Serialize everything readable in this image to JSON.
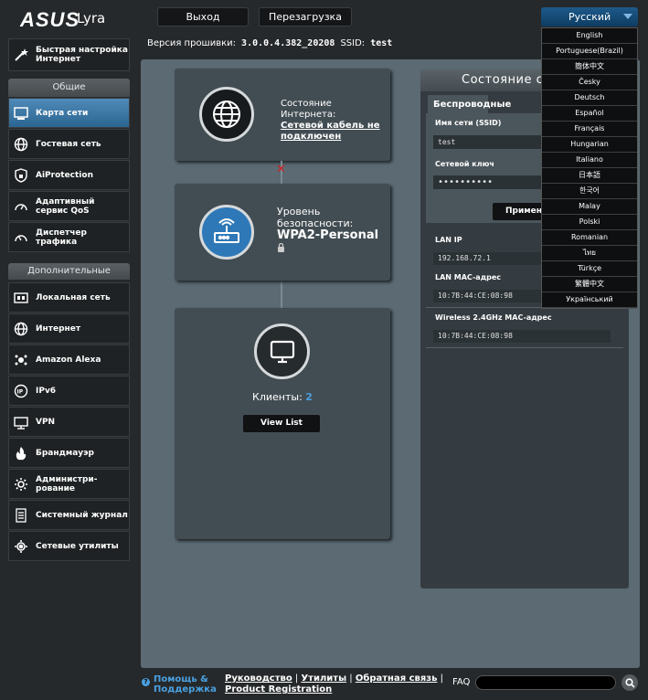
{
  "header": {
    "logo": "ASUS",
    "model": "Lyra",
    "logout_label": "Выход",
    "reboot_label": "Перезагрузка",
    "language_current": "Русский",
    "firmware_label": "Версия прошивки:",
    "firmware_value": "3.0.0.4.382_20208",
    "ssid_label": "SSID:",
    "ssid_value": "test"
  },
  "sidebar": {
    "quick_setup": "Быстрая настройка Интернет",
    "general_title": "Общие",
    "general_items": [
      {
        "label": "Карта сети",
        "icon": "network-map-icon"
      },
      {
        "label": "Гостевая сеть",
        "icon": "globe-icon"
      },
      {
        "label": "AiProtection",
        "icon": "shield-lock-icon"
      },
      {
        "label": "Адаптивный сервис QoS",
        "icon": "speedometer-icon"
      },
      {
        "label": "Диспетчер трафика",
        "icon": "gauge-icon"
      }
    ],
    "advanced_title": "Дополнительные настройки",
    "advanced_items": [
      {
        "label": "Локальная сеть",
        "icon": "lan-icon"
      },
      {
        "label": "Интернет",
        "icon": "globe-icon"
      },
      {
        "label": "Amazon Alexa",
        "icon": "alexa-icon"
      },
      {
        "label": "IPv6",
        "icon": "ipv6-icon"
      },
      {
        "label": "VPN",
        "icon": "vpn-icon"
      },
      {
        "label": "Брандмауэр",
        "icon": "firewall-icon"
      },
      {
        "label": "Администри-рование",
        "icon": "admin-icon"
      },
      {
        "label": "Системный журнал",
        "icon": "log-icon"
      },
      {
        "label": "Сетевые утилиты",
        "icon": "tools-icon"
      }
    ]
  },
  "network_map": {
    "internet_status_label": "Состояние Интернета:",
    "internet_status_value": "Сетевой кабель не подключен",
    "security_label": "Уровень безопасности:",
    "security_value": "WPA2-Personal",
    "clients_label": "Клиенты:",
    "clients_count": "2",
    "view_list_label": "View List"
  },
  "status_panel": {
    "title": "Состояние с",
    "tab_wireless": "Беспроводные",
    "ssid_label": "Имя сети (SSID)",
    "ssid_value": "test",
    "key_label": "Сетевой ключ",
    "key_value": "••••••••••",
    "apply_label": "Примен",
    "lan_ip_label": "LAN IP",
    "lan_ip_value": "192.168.72.1",
    "lan_mac_label": "LAN MAC-адрес",
    "lan_mac_value": "10:7B:44:CE:08:98",
    "wl_mac_label": "Wireless 2.4GHz MAC-адрес",
    "wl_mac_value": "10:7B:44:CE:08:98"
  },
  "languages": [
    "English",
    "Portuguese(Brazil)",
    "簡体中文",
    "Česky",
    "Deutsch",
    "Español",
    "Français",
    "Hungarian",
    "Italiano",
    "日本語",
    "한국어",
    "Malay",
    "Polski",
    "Romanian",
    "ไทย",
    "Türkçe",
    "繁體中文",
    "Український"
  ],
  "footer": {
    "help_line1": "Помощь &",
    "help_line2": "Поддержка",
    "links": [
      "Руководство",
      "Утилиты",
      "Обратная связь",
      "Product Registration"
    ],
    "faq_label": "FAQ",
    "faq_placeholder": ""
  },
  "colors": {
    "accent": "#2c6591",
    "clients_count": "#4aa0e0",
    "disconnect_x": "#d02020"
  }
}
